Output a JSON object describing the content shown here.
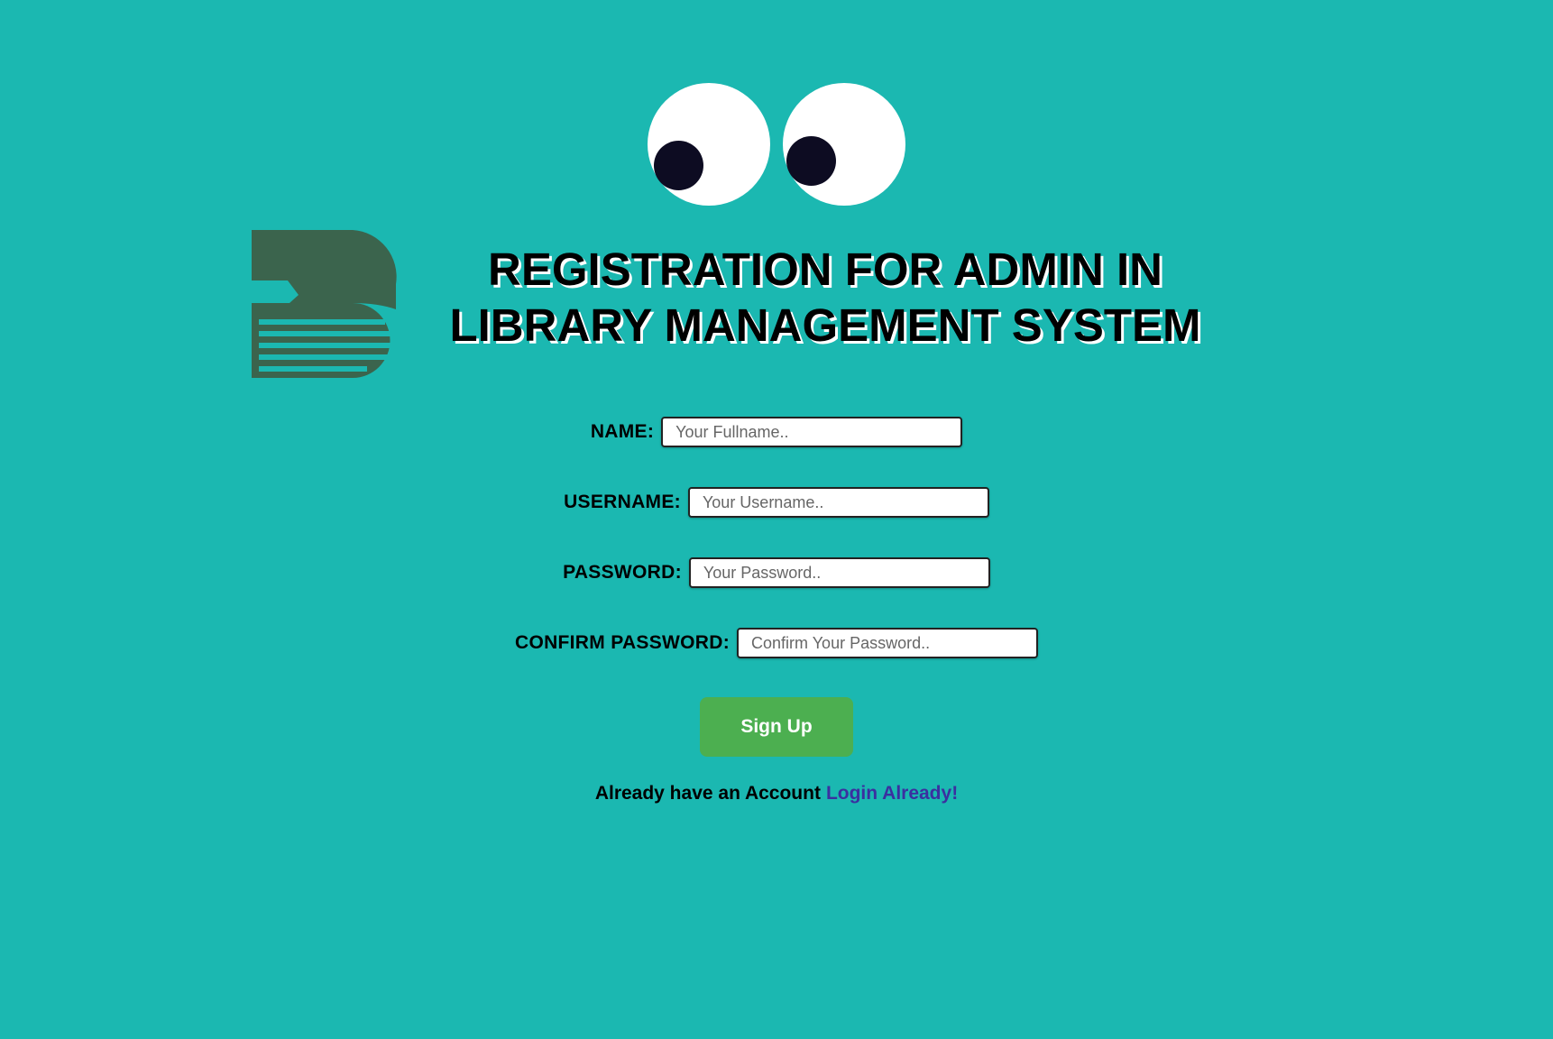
{
  "page": {
    "background_color": "#1bb8b1"
  },
  "header": {
    "title_line1": "REGISTRATION FOR ADMIN IN",
    "title_line2": "LIBRARY MANAGEMENT SYSTEM",
    "logo_icon": "book-logo-icon",
    "mascot_icon": "googly-eyes-icon"
  },
  "form": {
    "name": {
      "label": "NAME:",
      "value": "",
      "placeholder": "Your Fullname.."
    },
    "username": {
      "label": "USERNAME:",
      "value": "",
      "placeholder": "Your Username.."
    },
    "password": {
      "label": "PASSWORD:",
      "value": "",
      "placeholder": "Your Password.."
    },
    "confirm_password": {
      "label": "CONFIRM PASSWORD:",
      "value": "",
      "placeholder": "Confirm Your Password.."
    },
    "submit_label": "Sign Up",
    "submit_color": "#4caf50"
  },
  "footer": {
    "prompt_text": "Already have an Account",
    "login_link_text": "Login Already!",
    "link_color": "#3b2fa0"
  }
}
